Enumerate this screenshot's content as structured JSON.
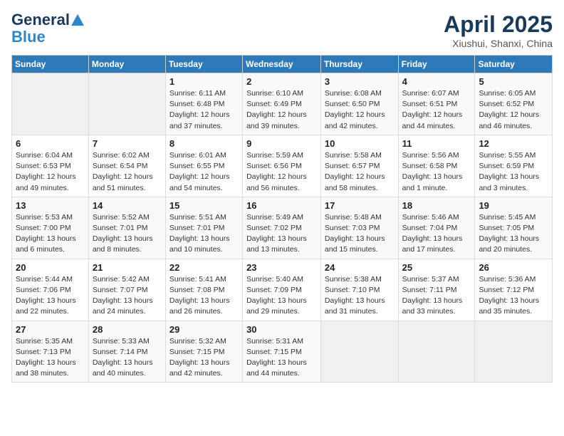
{
  "logo": {
    "line1": "General",
    "line2": "Blue"
  },
  "title": "April 2025",
  "location": "Xiushui, Shanxi, China",
  "weekdays": [
    "Sunday",
    "Monday",
    "Tuesday",
    "Wednesday",
    "Thursday",
    "Friday",
    "Saturday"
  ],
  "weeks": [
    [
      {
        "day": "",
        "info": ""
      },
      {
        "day": "",
        "info": ""
      },
      {
        "day": "1",
        "info": "Sunrise: 6:11 AM\nSunset: 6:48 PM\nDaylight: 12 hours\nand 37 minutes."
      },
      {
        "day": "2",
        "info": "Sunrise: 6:10 AM\nSunset: 6:49 PM\nDaylight: 12 hours\nand 39 minutes."
      },
      {
        "day": "3",
        "info": "Sunrise: 6:08 AM\nSunset: 6:50 PM\nDaylight: 12 hours\nand 42 minutes."
      },
      {
        "day": "4",
        "info": "Sunrise: 6:07 AM\nSunset: 6:51 PM\nDaylight: 12 hours\nand 44 minutes."
      },
      {
        "day": "5",
        "info": "Sunrise: 6:05 AM\nSunset: 6:52 PM\nDaylight: 12 hours\nand 46 minutes."
      }
    ],
    [
      {
        "day": "6",
        "info": "Sunrise: 6:04 AM\nSunset: 6:53 PM\nDaylight: 12 hours\nand 49 minutes."
      },
      {
        "day": "7",
        "info": "Sunrise: 6:02 AM\nSunset: 6:54 PM\nDaylight: 12 hours\nand 51 minutes."
      },
      {
        "day": "8",
        "info": "Sunrise: 6:01 AM\nSunset: 6:55 PM\nDaylight: 12 hours\nand 54 minutes."
      },
      {
        "day": "9",
        "info": "Sunrise: 5:59 AM\nSunset: 6:56 PM\nDaylight: 12 hours\nand 56 minutes."
      },
      {
        "day": "10",
        "info": "Sunrise: 5:58 AM\nSunset: 6:57 PM\nDaylight: 12 hours\nand 58 minutes."
      },
      {
        "day": "11",
        "info": "Sunrise: 5:56 AM\nSunset: 6:58 PM\nDaylight: 13 hours\nand 1 minute."
      },
      {
        "day": "12",
        "info": "Sunrise: 5:55 AM\nSunset: 6:59 PM\nDaylight: 13 hours\nand 3 minutes."
      }
    ],
    [
      {
        "day": "13",
        "info": "Sunrise: 5:53 AM\nSunset: 7:00 PM\nDaylight: 13 hours\nand 6 minutes."
      },
      {
        "day": "14",
        "info": "Sunrise: 5:52 AM\nSunset: 7:01 PM\nDaylight: 13 hours\nand 8 minutes."
      },
      {
        "day": "15",
        "info": "Sunrise: 5:51 AM\nSunset: 7:01 PM\nDaylight: 13 hours\nand 10 minutes."
      },
      {
        "day": "16",
        "info": "Sunrise: 5:49 AM\nSunset: 7:02 PM\nDaylight: 13 hours\nand 13 minutes."
      },
      {
        "day": "17",
        "info": "Sunrise: 5:48 AM\nSunset: 7:03 PM\nDaylight: 13 hours\nand 15 minutes."
      },
      {
        "day": "18",
        "info": "Sunrise: 5:46 AM\nSunset: 7:04 PM\nDaylight: 13 hours\nand 17 minutes."
      },
      {
        "day": "19",
        "info": "Sunrise: 5:45 AM\nSunset: 7:05 PM\nDaylight: 13 hours\nand 20 minutes."
      }
    ],
    [
      {
        "day": "20",
        "info": "Sunrise: 5:44 AM\nSunset: 7:06 PM\nDaylight: 13 hours\nand 22 minutes."
      },
      {
        "day": "21",
        "info": "Sunrise: 5:42 AM\nSunset: 7:07 PM\nDaylight: 13 hours\nand 24 minutes."
      },
      {
        "day": "22",
        "info": "Sunrise: 5:41 AM\nSunset: 7:08 PM\nDaylight: 13 hours\nand 26 minutes."
      },
      {
        "day": "23",
        "info": "Sunrise: 5:40 AM\nSunset: 7:09 PM\nDaylight: 13 hours\nand 29 minutes."
      },
      {
        "day": "24",
        "info": "Sunrise: 5:38 AM\nSunset: 7:10 PM\nDaylight: 13 hours\nand 31 minutes."
      },
      {
        "day": "25",
        "info": "Sunrise: 5:37 AM\nSunset: 7:11 PM\nDaylight: 13 hours\nand 33 minutes."
      },
      {
        "day": "26",
        "info": "Sunrise: 5:36 AM\nSunset: 7:12 PM\nDaylight: 13 hours\nand 35 minutes."
      }
    ],
    [
      {
        "day": "27",
        "info": "Sunrise: 5:35 AM\nSunset: 7:13 PM\nDaylight: 13 hours\nand 38 minutes."
      },
      {
        "day": "28",
        "info": "Sunrise: 5:33 AM\nSunset: 7:14 PM\nDaylight: 13 hours\nand 40 minutes."
      },
      {
        "day": "29",
        "info": "Sunrise: 5:32 AM\nSunset: 7:15 PM\nDaylight: 13 hours\nand 42 minutes."
      },
      {
        "day": "30",
        "info": "Sunrise: 5:31 AM\nSunset: 7:15 PM\nDaylight: 13 hours\nand 44 minutes."
      },
      {
        "day": "",
        "info": ""
      },
      {
        "day": "",
        "info": ""
      },
      {
        "day": "",
        "info": ""
      }
    ]
  ]
}
